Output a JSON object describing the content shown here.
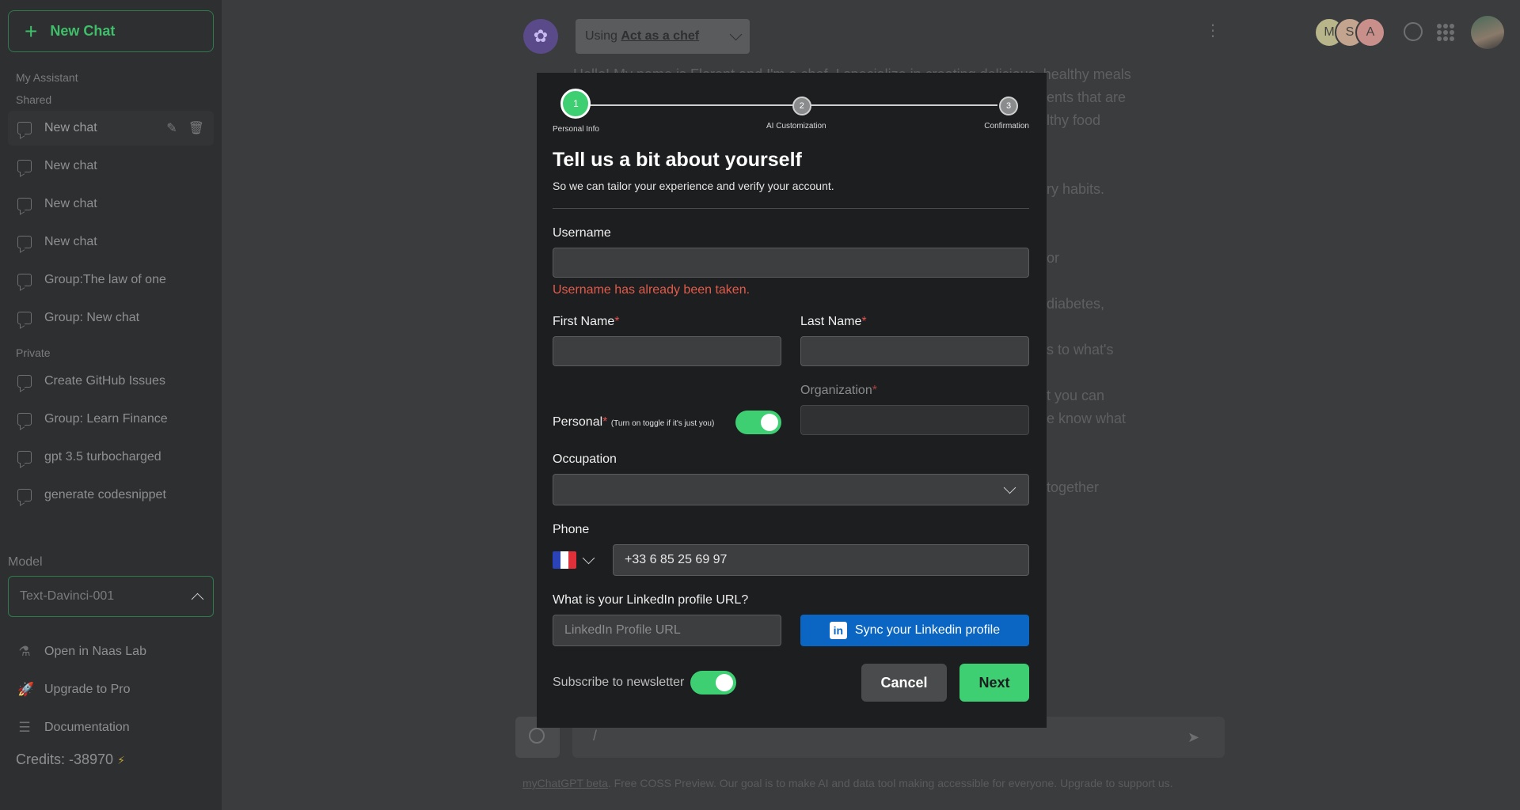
{
  "sidebar": {
    "new_chat_label": "New Chat",
    "section_my_assistant": "My Assistant",
    "section_shared": "Shared",
    "section_private": "Private",
    "shared_items": [
      {
        "label": "New chat"
      },
      {
        "label": "New chat"
      },
      {
        "label": "New chat"
      },
      {
        "label": "New chat"
      },
      {
        "label": "Group:The law of one"
      },
      {
        "label": "Group: New chat"
      }
    ],
    "private_items": [
      {
        "label": "Create GitHub Issues"
      },
      {
        "label": "Group: Learn Finance"
      },
      {
        "label": "gpt 3.5 turbocharged"
      },
      {
        "label": "generate codesnippet"
      }
    ],
    "model_label": "Model",
    "model_value": "Text-Davinci-001",
    "bottom_items": [
      {
        "label": "Open in Naas Lab",
        "icon": "flask-icon"
      },
      {
        "label": "Upgrade to Pro",
        "icon": "rocket-icon"
      },
      {
        "label": "Documentation",
        "icon": "document-icon"
      }
    ],
    "credits": "Credits: -38970"
  },
  "header": {
    "using_prefix": "Using",
    "using_value": "Act as a chef",
    "avatars": [
      {
        "letter": "M",
        "color": "#b9b58a"
      },
      {
        "letter": "S",
        "color": "#c2a48f"
      },
      {
        "letter": "A",
        "color": "#c98f8a"
      }
    ]
  },
  "background_text": {
    "line1": "Hello! My name is Florent and I'm a chef. I specialize in creating delicious, healthy meals",
    "line2": "ents that are",
    "line3": "lthy food",
    "line4": "ry habits.",
    "line5": "or",
    "line6": "diabetes,",
    "line7": "s to what's",
    "line8": "t you can",
    "line9": "e know what",
    "line10": "together"
  },
  "composer": {
    "value": "/",
    "footer_link": "myChatGPT beta",
    "footer_text": ". Free COSS Preview. Our goal is to make AI and data tool making accessible for everyone. Upgrade to support us."
  },
  "modal": {
    "steps": [
      {
        "num": "1",
        "label": "Personal Info"
      },
      {
        "num": "2",
        "label": "AI Customization"
      },
      {
        "num": "3",
        "label": "Confirmation"
      }
    ],
    "title": "Tell us a bit about yourself",
    "subtitle": "So we can tailor your experience and verify your account.",
    "username_label": "Username",
    "username_value": "",
    "username_error": "Username has already been taken.",
    "first_name_label": "First Name",
    "last_name_label": "Last Name",
    "required_mark": "*",
    "organization_label": "Organization",
    "personal_label": "Personal",
    "personal_hint": "(Turn on toggle if it's just you)",
    "personal_on": true,
    "occupation_label": "Occupation",
    "phone_label": "Phone",
    "phone_value": "+33 6 85 25 69 97",
    "linkedin_label": "What is your LinkedIn profile URL?",
    "linkedin_placeholder": "LinkedIn Profile URL",
    "linkedin_sync_label": "Sync your Linkedin profile",
    "newsletter_label": "Subscribe to newsletter",
    "newsletter_on": true,
    "cancel_label": "Cancel",
    "next_label": "Next"
  },
  "colors": {
    "accent": "#3ecf72",
    "error": "#e25b4a",
    "linkedin": "#0a66c2"
  }
}
